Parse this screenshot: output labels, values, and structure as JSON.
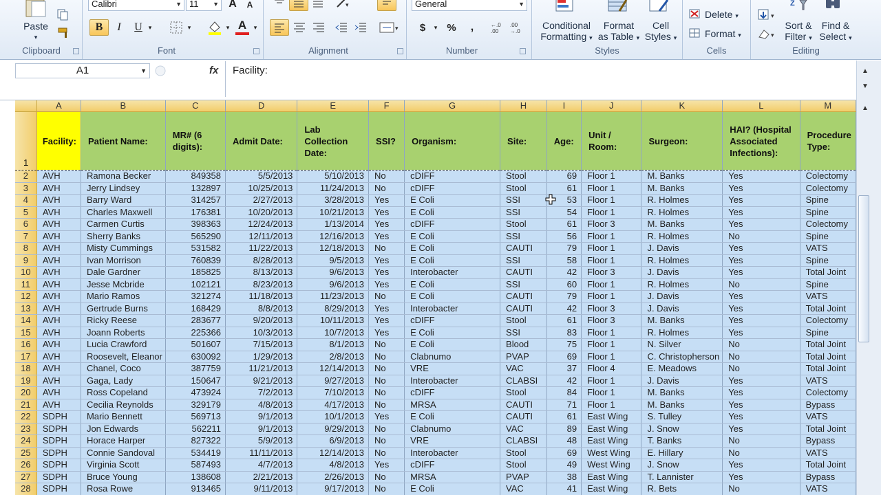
{
  "ribbon": {
    "clipboard": {
      "paste_label": "Paste",
      "group_label": "Clipboard"
    },
    "font": {
      "name": "Calibri",
      "size": "11",
      "group_label": "Font",
      "bold": "B",
      "italic": "I",
      "underline": "U",
      "grow": "A",
      "shrink": "A"
    },
    "alignment": {
      "group_label": "Alignment"
    },
    "number": {
      "format": "General",
      "currency": "$",
      "percent": "%",
      "comma": ",",
      "group_label": "Number"
    },
    "styles": {
      "conditional_formatting": [
        "Conditional",
        "Formatting"
      ],
      "format_as_table": [
        "Format",
        "as Table"
      ],
      "cell_styles": [
        "Cell",
        "Styles"
      ],
      "group_label": "Styles"
    },
    "cells": {
      "delete_label": "Delete",
      "format_label": "Format",
      "group_label": "Cells"
    },
    "editing": {
      "sort_filter": [
        "Sort &",
        "Filter"
      ],
      "find_select": [
        "Find &",
        "Select"
      ],
      "group_label": "Editing"
    }
  },
  "formula_bar": {
    "name_box": "A1",
    "fx": "fx",
    "formula": "Facility:"
  },
  "columns": [
    "A",
    "B",
    "C",
    "D",
    "E",
    "F",
    "G",
    "H",
    "I",
    "J",
    "K",
    "L",
    "M"
  ],
  "headers": [
    "Facility:",
    "Patient Name:",
    "MR# (6 digits):",
    "Admit Date:",
    "Lab Collection Date:",
    "SSI?",
    "Organism:",
    "Site:",
    "Age:",
    "Unit / Room:",
    "Surgeon:",
    "HAI? (Hospital Associated Infections):",
    "Procedure Type:"
  ],
  "rows": [
    [
      "AVH",
      "Ramona Becker",
      "849358",
      "5/5/2013",
      "5/10/2013",
      "No",
      "cDIFF",
      "Stool",
      "69",
      "Floor 1",
      "M. Banks",
      "Yes",
      "Colectomy"
    ],
    [
      "AVH",
      "Jerry Lindsey",
      "132897",
      "10/25/2013",
      "11/24/2013",
      "No",
      "cDIFF",
      "Stool",
      "61",
      "Floor 1",
      "M. Banks",
      "Yes",
      "Colectomy"
    ],
    [
      "AVH",
      "Barry Ward",
      "314257",
      "2/27/2013",
      "3/28/2013",
      "Yes",
      "E Coli",
      "SSI",
      "53",
      "Floor 1",
      "R. Holmes",
      "Yes",
      "Spine"
    ],
    [
      "AVH",
      "Charles Maxwell",
      "176381",
      "10/20/2013",
      "10/21/2013",
      "Yes",
      "E Coli",
      "SSI",
      "54",
      "Floor 1",
      "R. Holmes",
      "Yes",
      "Spine"
    ],
    [
      "AVH",
      "Carmen Curtis",
      "398363",
      "12/24/2013",
      "1/13/2014",
      "Yes",
      "cDIFF",
      "Stool",
      "61",
      "Floor 3",
      "M. Banks",
      "Yes",
      "Colectomy"
    ],
    [
      "AVH",
      "Sherry Banks",
      "565290",
      "12/11/2013",
      "12/16/2013",
      "Yes",
      "E Coli",
      "SSI",
      "56",
      "Floor 1",
      "R. Holmes",
      "No",
      "Spine"
    ],
    [
      "AVH",
      "Misty Cummings",
      "531582",
      "11/22/2013",
      "12/18/2013",
      "No",
      "E Coli",
      "CAUTI",
      "79",
      "Floor 1",
      "J. Davis",
      "Yes",
      "VATS"
    ],
    [
      "AVH",
      "Ivan Morrison",
      "760839",
      "8/28/2013",
      "9/5/2013",
      "Yes",
      "E Coli",
      "SSI",
      "58",
      "Floor 1",
      "R. Holmes",
      "Yes",
      "Spine"
    ],
    [
      "AVH",
      "Dale Gardner",
      "185825",
      "8/13/2013",
      "9/6/2013",
      "Yes",
      "Interobacter",
      "CAUTI",
      "42",
      "Floor 3",
      "J. Davis",
      "Yes",
      "Total Joint"
    ],
    [
      "AVH",
      "Jesse Mcbride",
      "102121",
      "8/23/2013",
      "9/6/2013",
      "Yes",
      "E Coli",
      "SSI",
      "60",
      "Floor 1",
      "R. Holmes",
      "No",
      "Spine"
    ],
    [
      "AVH",
      "Mario Ramos",
      "321274",
      "11/18/2013",
      "11/23/2013",
      "No",
      "E Coli",
      "CAUTI",
      "79",
      "Floor 1",
      "J. Davis",
      "Yes",
      "VATS"
    ],
    [
      "AVH",
      "Gertrude Burns",
      "168429",
      "8/8/2013",
      "8/29/2013",
      "Yes",
      "Interobacter",
      "CAUTI",
      "42",
      "Floor 3",
      "J. Davis",
      "Yes",
      "Total Joint"
    ],
    [
      "AVH",
      "Ricky Reese",
      "283677",
      "9/20/2013",
      "10/11/2013",
      "Yes",
      "cDIFF",
      "Stool",
      "61",
      "Floor 3",
      "M. Banks",
      "Yes",
      "Colectomy"
    ],
    [
      "AVH",
      "Joann Roberts",
      "225366",
      "10/3/2013",
      "10/7/2013",
      "Yes",
      "E Coli",
      "SSI",
      "83",
      "Floor 1",
      "R. Holmes",
      "Yes",
      "Spine"
    ],
    [
      "AVH",
      "Lucia Crawford",
      "501607",
      "7/15/2013",
      "8/1/2013",
      "No",
      "E Coli",
      "Blood",
      "75",
      "Floor 1",
      "N. Silver",
      "No",
      "Total Joint"
    ],
    [
      "AVH",
      "Roosevelt, Eleanor",
      "630092",
      "1/29/2013",
      "2/8/2013",
      "No",
      "Clabnumo",
      "PVAP",
      "69",
      "Floor 1",
      "C. Christopherson",
      "No",
      "Total Joint"
    ],
    [
      "AVH",
      "Chanel, Coco",
      "387759",
      "11/21/2013",
      "12/14/2013",
      "No",
      "VRE",
      "VAC",
      "37",
      "Floor 4",
      "E. Meadows",
      "No",
      "Total Joint"
    ],
    [
      "AVH",
      "Gaga, Lady",
      "150647",
      "9/21/2013",
      "9/27/2013",
      "No",
      "Interobacter",
      "CLABSI",
      "42",
      "Floor 1",
      "J. Davis",
      "Yes",
      "VATS"
    ],
    [
      "AVH",
      "Ross Copeland",
      "473924",
      "7/2/2013",
      "7/10/2013",
      "No",
      "cDIFF",
      "Stool",
      "84",
      "Floor 1",
      "M. Banks",
      "Yes",
      "Colectomy"
    ],
    [
      "AVH",
      "Cecilia Reynolds",
      "329179",
      "4/8/2013",
      "4/17/2013",
      "No",
      "MRSA",
      "CAUTI",
      "71",
      "Floor 1",
      "M. Banks",
      "Yes",
      "Bypass"
    ],
    [
      "SDPH",
      "Mario Bennett",
      "569713",
      "9/1/2013",
      "10/1/2013",
      "Yes",
      "E Coli",
      "CAUTI",
      "61",
      "East Wing",
      "S. Tulley",
      "Yes",
      "VATS"
    ],
    [
      "SDPH",
      "Jon Edwards",
      "562211",
      "9/1/2013",
      "9/29/2013",
      "No",
      "Clabnumo",
      "VAC",
      "89",
      "East Wing",
      "J. Snow",
      "Yes",
      "Total Joint"
    ],
    [
      "SDPH",
      "Horace Harper",
      "827322",
      "5/9/2013",
      "6/9/2013",
      "No",
      "VRE",
      "CLABSI",
      "48",
      "East Wing",
      "T. Banks",
      "No",
      "Bypass"
    ],
    [
      "SDPH",
      "Connie Sandoval",
      "534419",
      "11/11/2013",
      "12/14/2013",
      "No",
      "Interobacter",
      "Stool",
      "69",
      "West Wing",
      "E. Hillary",
      "No",
      "VATS"
    ],
    [
      "SDPH",
      "Virginia Scott",
      "587493",
      "4/7/2013",
      "4/8/2013",
      "Yes",
      "cDIFF",
      "Stool",
      "49",
      "West Wing",
      "J. Snow",
      "Yes",
      "Total Joint"
    ],
    [
      "SDPH",
      "Bruce Young",
      "138608",
      "2/21/2013",
      "2/26/2013",
      "No",
      "MRSA",
      "PVAP",
      "38",
      "East Wing",
      "T. Lannister",
      "Yes",
      "Bypass"
    ],
    [
      "SDPH",
      "Rosa Rowe",
      "913465",
      "9/11/2013",
      "9/17/2013",
      "No",
      "E Coli",
      "VAC",
      "41",
      "East Wing",
      "R. Bets",
      "No",
      "VATS"
    ]
  ],
  "colors": {
    "header_fill": "#a8d16f",
    "selected_fill": "#ffff00",
    "row_fill": "#c6def5",
    "row_header": "#f2cd6a"
  }
}
